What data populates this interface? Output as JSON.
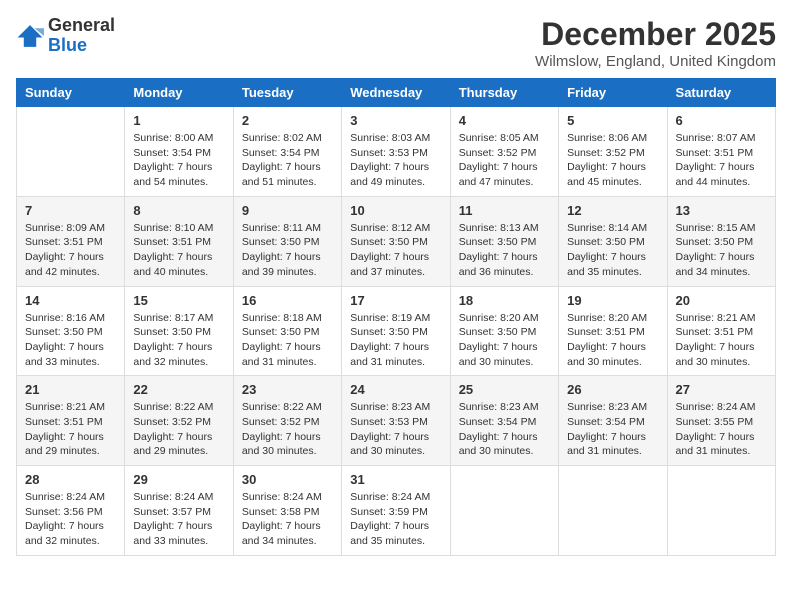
{
  "logo": {
    "general": "General",
    "blue": "Blue"
  },
  "title": "December 2025",
  "location": "Wilmslow, England, United Kingdom",
  "days_of_week": [
    "Sunday",
    "Monday",
    "Tuesday",
    "Wednesday",
    "Thursday",
    "Friday",
    "Saturday"
  ],
  "weeks": [
    [
      {
        "day": null,
        "shaded": false
      },
      {
        "day": 1,
        "sunrise": "8:00 AM",
        "sunset": "3:54 PM",
        "daylight": "7 hours and 54 minutes.",
        "shaded": false
      },
      {
        "day": 2,
        "sunrise": "8:02 AM",
        "sunset": "3:54 PM",
        "daylight": "7 hours and 51 minutes.",
        "shaded": false
      },
      {
        "day": 3,
        "sunrise": "8:03 AM",
        "sunset": "3:53 PM",
        "daylight": "7 hours and 49 minutes.",
        "shaded": false
      },
      {
        "day": 4,
        "sunrise": "8:05 AM",
        "sunset": "3:52 PM",
        "daylight": "7 hours and 47 minutes.",
        "shaded": false
      },
      {
        "day": 5,
        "sunrise": "8:06 AM",
        "sunset": "3:52 PM",
        "daylight": "7 hours and 45 minutes.",
        "shaded": false
      },
      {
        "day": 6,
        "sunrise": "8:07 AM",
        "sunset": "3:51 PM",
        "daylight": "7 hours and 44 minutes.",
        "shaded": false
      }
    ],
    [
      {
        "day": 7,
        "sunrise": "8:09 AM",
        "sunset": "3:51 PM",
        "daylight": "7 hours and 42 minutes.",
        "shaded": true
      },
      {
        "day": 8,
        "sunrise": "8:10 AM",
        "sunset": "3:51 PM",
        "daylight": "7 hours and 40 minutes.",
        "shaded": true
      },
      {
        "day": 9,
        "sunrise": "8:11 AM",
        "sunset": "3:50 PM",
        "daylight": "7 hours and 39 minutes.",
        "shaded": true
      },
      {
        "day": 10,
        "sunrise": "8:12 AM",
        "sunset": "3:50 PM",
        "daylight": "7 hours and 37 minutes.",
        "shaded": true
      },
      {
        "day": 11,
        "sunrise": "8:13 AM",
        "sunset": "3:50 PM",
        "daylight": "7 hours and 36 minutes.",
        "shaded": true
      },
      {
        "day": 12,
        "sunrise": "8:14 AM",
        "sunset": "3:50 PM",
        "daylight": "7 hours and 35 minutes.",
        "shaded": true
      },
      {
        "day": 13,
        "sunrise": "8:15 AM",
        "sunset": "3:50 PM",
        "daylight": "7 hours and 34 minutes.",
        "shaded": true
      }
    ],
    [
      {
        "day": 14,
        "sunrise": "8:16 AM",
        "sunset": "3:50 PM",
        "daylight": "7 hours and 33 minutes.",
        "shaded": false
      },
      {
        "day": 15,
        "sunrise": "8:17 AM",
        "sunset": "3:50 PM",
        "daylight": "7 hours and 32 minutes.",
        "shaded": false
      },
      {
        "day": 16,
        "sunrise": "8:18 AM",
        "sunset": "3:50 PM",
        "daylight": "7 hours and 31 minutes.",
        "shaded": false
      },
      {
        "day": 17,
        "sunrise": "8:19 AM",
        "sunset": "3:50 PM",
        "daylight": "7 hours and 31 minutes.",
        "shaded": false
      },
      {
        "day": 18,
        "sunrise": "8:20 AM",
        "sunset": "3:50 PM",
        "daylight": "7 hours and 30 minutes.",
        "shaded": false
      },
      {
        "day": 19,
        "sunrise": "8:20 AM",
        "sunset": "3:51 PM",
        "daylight": "7 hours and 30 minutes.",
        "shaded": false
      },
      {
        "day": 20,
        "sunrise": "8:21 AM",
        "sunset": "3:51 PM",
        "daylight": "7 hours and 30 minutes.",
        "shaded": false
      }
    ],
    [
      {
        "day": 21,
        "sunrise": "8:21 AM",
        "sunset": "3:51 PM",
        "daylight": "7 hours and 29 minutes.",
        "shaded": true
      },
      {
        "day": 22,
        "sunrise": "8:22 AM",
        "sunset": "3:52 PM",
        "daylight": "7 hours and 29 minutes.",
        "shaded": true
      },
      {
        "day": 23,
        "sunrise": "8:22 AM",
        "sunset": "3:52 PM",
        "daylight": "7 hours and 30 minutes.",
        "shaded": true
      },
      {
        "day": 24,
        "sunrise": "8:23 AM",
        "sunset": "3:53 PM",
        "daylight": "7 hours and 30 minutes.",
        "shaded": true
      },
      {
        "day": 25,
        "sunrise": "8:23 AM",
        "sunset": "3:54 PM",
        "daylight": "7 hours and 30 minutes.",
        "shaded": true
      },
      {
        "day": 26,
        "sunrise": "8:23 AM",
        "sunset": "3:54 PM",
        "daylight": "7 hours and 31 minutes.",
        "shaded": true
      },
      {
        "day": 27,
        "sunrise": "8:24 AM",
        "sunset": "3:55 PM",
        "daylight": "7 hours and 31 minutes.",
        "shaded": true
      }
    ],
    [
      {
        "day": 28,
        "sunrise": "8:24 AM",
        "sunset": "3:56 PM",
        "daylight": "7 hours and 32 minutes.",
        "shaded": false
      },
      {
        "day": 29,
        "sunrise": "8:24 AM",
        "sunset": "3:57 PM",
        "daylight": "7 hours and 33 minutes.",
        "shaded": false
      },
      {
        "day": 30,
        "sunrise": "8:24 AM",
        "sunset": "3:58 PM",
        "daylight": "7 hours and 34 minutes.",
        "shaded": false
      },
      {
        "day": 31,
        "sunrise": "8:24 AM",
        "sunset": "3:59 PM",
        "daylight": "7 hours and 35 minutes.",
        "shaded": false
      },
      {
        "day": null,
        "shaded": false
      },
      {
        "day": null,
        "shaded": false
      },
      {
        "day": null,
        "shaded": false
      }
    ]
  ],
  "labels": {
    "sunrise": "Sunrise:",
    "sunset": "Sunset:",
    "daylight": "Daylight:"
  }
}
